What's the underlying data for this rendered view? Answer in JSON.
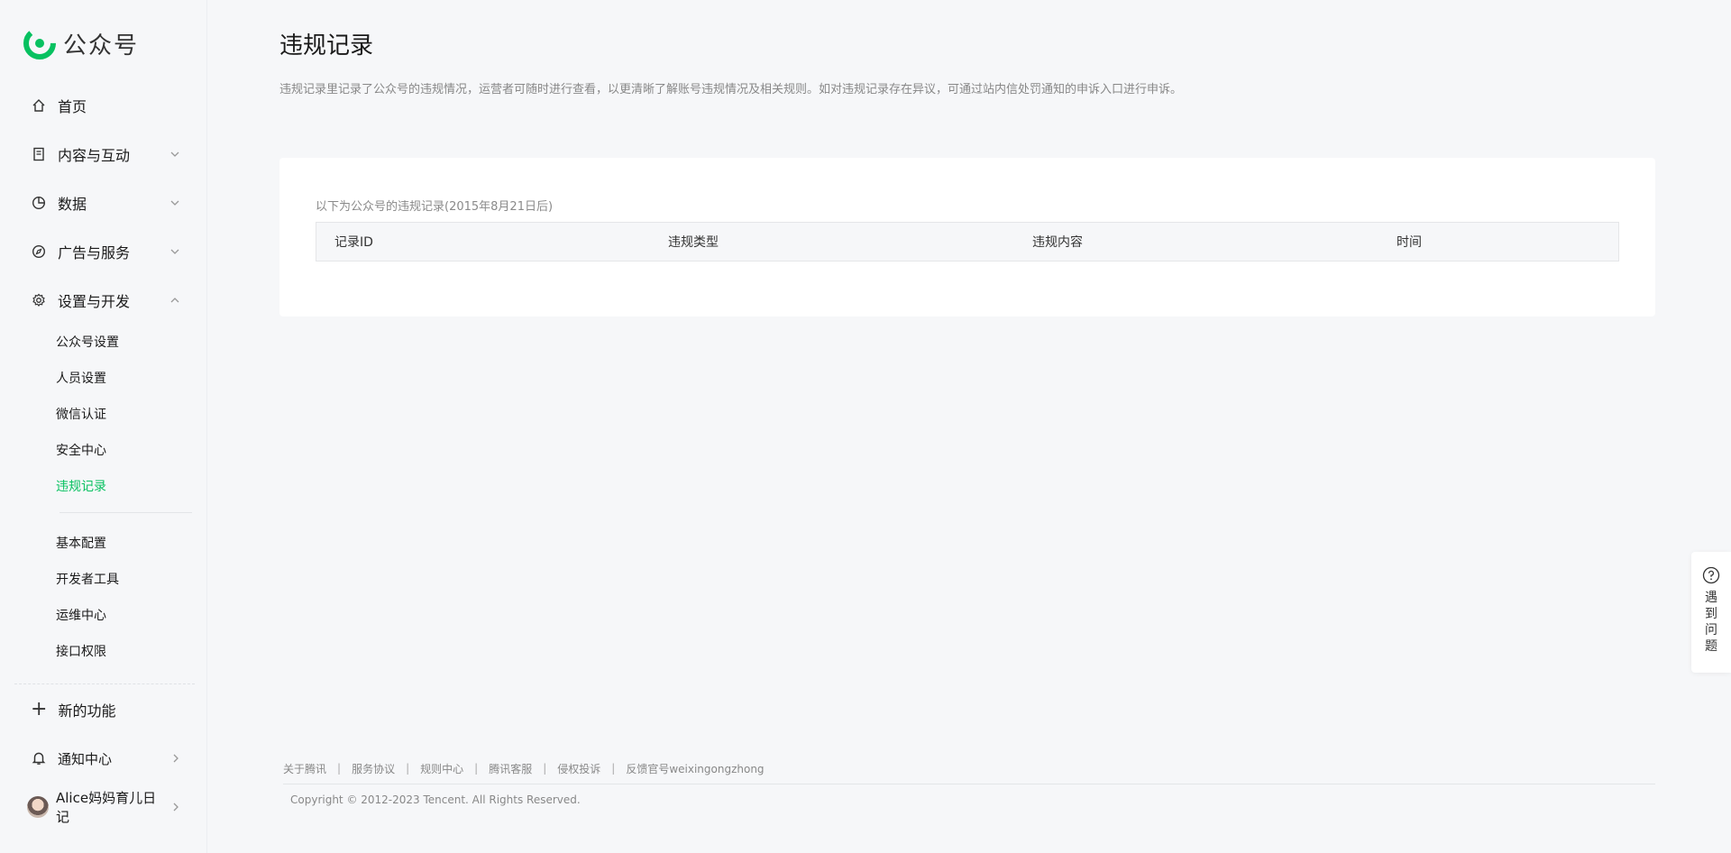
{
  "brand": {
    "name": "公众号",
    "color": "#07c160"
  },
  "sidebar": {
    "home": "首页",
    "content": "内容与互动",
    "data": "数据",
    "ads": "广告与服务",
    "settings": "设置与开发",
    "settings_sub": [
      "公众号设置",
      "人员设置",
      "微信认证",
      "安全中心",
      "违规记录"
    ],
    "dev_sub": [
      "基本配置",
      "开发者工具",
      "运维中心",
      "接口权限"
    ],
    "new_features": "新的功能",
    "notifications": "通知中心",
    "account": "Alice妈妈育儿日记"
  },
  "page": {
    "title": "违规记录",
    "description": "违规记录里记录了公众号的违规情况，运营者可随时进行查看，以更清晰了解账号违规情况及相关规则。如对违规记录存在异议，可通过站内信处罚通知的申诉入口进行申诉。",
    "note": "以下为公众号的违规记录(2015年8月21日后)",
    "columns": [
      "记录ID",
      "违规类型",
      "违规内容",
      "时间"
    ]
  },
  "footer": {
    "links": [
      "关于腾讯",
      "服务协议",
      "规则中心",
      "腾讯客服",
      "侵权投诉",
      "反馈官号weixingongzhong"
    ],
    "copyright": "Copyright © 2012-2023 Tencent. All Rights Reserved."
  },
  "help": {
    "label": "遇到问题"
  }
}
